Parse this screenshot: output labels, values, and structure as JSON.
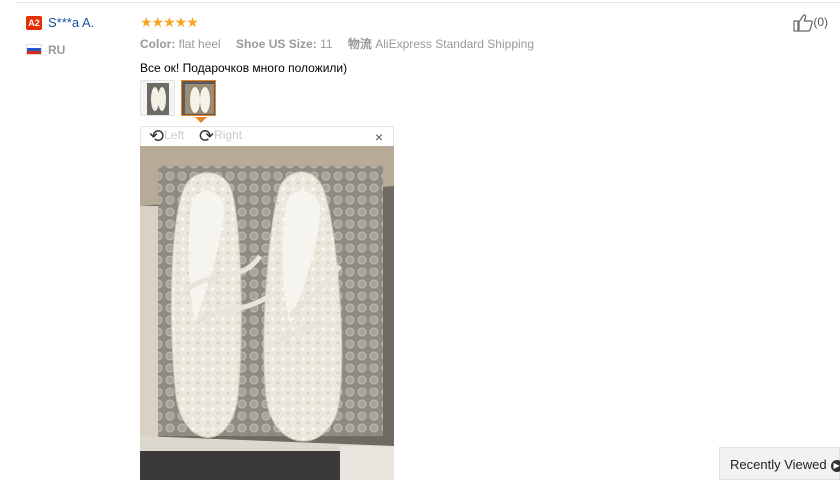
{
  "reviewer": {
    "level_badge": "A2",
    "name": "S***a A.",
    "country_code": "RU"
  },
  "review": {
    "rating": 5,
    "stars": "★★★★★",
    "attributes": [
      {
        "key": "Color:",
        "value": "flat heel"
      },
      {
        "key": "Shoe US Size:",
        "value": "11"
      },
      {
        "key": "物流",
        "value": "AliExpress Standard Shipping"
      }
    ],
    "text": "Все ок! Подарочков много положили)",
    "helpful_count": "(0)"
  },
  "viewer": {
    "rotate_left_label": "Left",
    "rotate_right_label": "Right",
    "close_symbol": "×",
    "thumbnail_count": 2,
    "selected_thumbnail": 2
  },
  "floating": {
    "recently_viewed_label": "Recently Viewed"
  },
  "colors": {
    "accent": "#e9862a",
    "star": "#f5a623",
    "name_link": "#1a4fa0",
    "badge": "#e62e04"
  },
  "icons": [
    "thumbs-up-icon",
    "rotate-left-icon",
    "rotate-right-icon",
    "close-icon",
    "flag-ru-icon",
    "chevron-icon"
  ]
}
